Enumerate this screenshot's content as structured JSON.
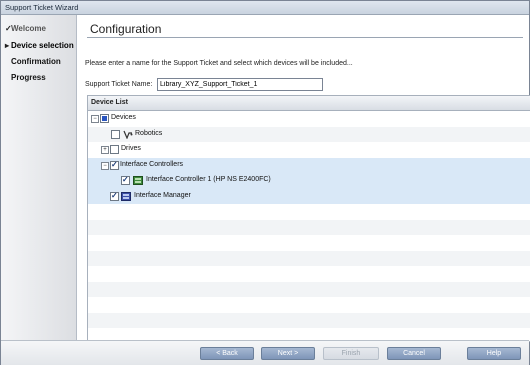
{
  "window": {
    "title": "Support Ticket Wizard"
  },
  "sidebar": {
    "steps": [
      {
        "mark": "✓",
        "label": "Welcome"
      },
      {
        "mark": "▸",
        "label": "Device selection"
      },
      {
        "mark": "",
        "label": "Confirmation"
      },
      {
        "mark": "",
        "label": "Progress"
      }
    ]
  },
  "main": {
    "heading": "Configuration",
    "instructions": "Please enter a name for the Support Ticket and select which devices will be included...",
    "name_label": "Support Ticket Name:",
    "name_value": "Library_XYZ_Support_Ticket_1"
  },
  "device_list": {
    "header": "Device List",
    "rows": [
      {
        "label": "Devices",
        "expander": "−",
        "state": "partial"
      },
      {
        "label": "Robotics",
        "expander": "",
        "state": "unchecked",
        "icon": "robotics-icon"
      },
      {
        "label": "Drives",
        "expander": "+",
        "state": "unchecked"
      },
      {
        "label": "Interface Controllers",
        "expander": "−",
        "state": "checked"
      },
      {
        "label": "Interface Controller 1 (HP NS E2400FC)",
        "expander": "",
        "state": "checked",
        "icon": "controller-icon"
      },
      {
        "label": "Interface Manager",
        "expander": "",
        "state": "checked",
        "icon": "manager-icon"
      }
    ]
  },
  "buttons": {
    "back": "< Back",
    "next": "Next >",
    "finish": "Finish",
    "cancel": "Cancel",
    "help": "Help"
  }
}
